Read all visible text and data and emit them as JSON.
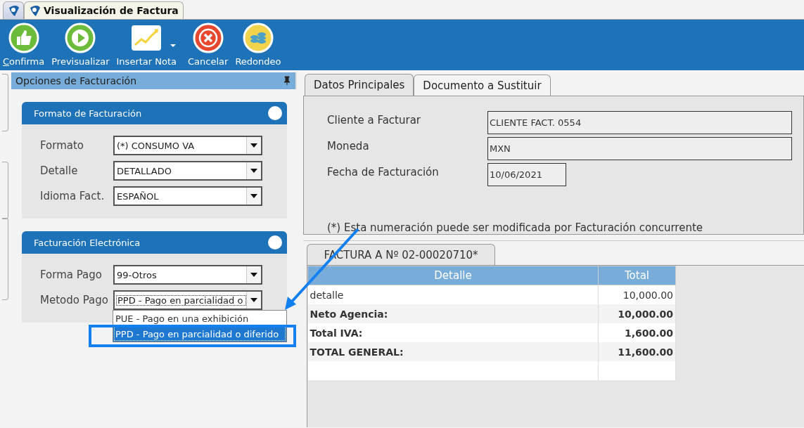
{
  "doc_tabs": [
    {
      "selected": false
    },
    {
      "label": "Visualización de Factura",
      "selected": true
    }
  ],
  "toolbar": [
    {
      "label": "Confirma",
      "underline_first": true,
      "has_menu": false
    },
    {
      "label": "Previsualizar",
      "underline_first": false,
      "has_menu": false
    },
    {
      "label": "Insertar Nota",
      "underline_first": false,
      "has_menu": true
    },
    {
      "label": "Cancelar",
      "underline_first": false,
      "has_menu": false
    },
    {
      "label": "Redondeo",
      "underline_first": false,
      "has_menu": false
    }
  ],
  "sidebar": {
    "title": "Opciones de Facturación",
    "groups": [
      {
        "title": "Formato de Facturación",
        "fields": [
          {
            "label": "Formato",
            "value": "(*) CONSUMO VA",
            "focused": false
          },
          {
            "label": "Detalle",
            "value": "DETALLADO",
            "focused": false
          },
          {
            "label": "Idioma Fact.",
            "value": "ESPAÑOL",
            "focused": false
          }
        ]
      },
      {
        "title": "Facturación Electrónica",
        "fields": [
          {
            "label": "Forma Pago",
            "value": "99-Otros",
            "focused": false
          },
          {
            "label": "Metodo Pago",
            "value": "PPD - Pago en parcialidad o",
            "focused": true,
            "options": [
              {
                "label": "PUE - Pago en una exhibición",
                "selected": false
              },
              {
                "label": "PPD - Pago en parcialidad o diferido",
                "selected": true,
                "annotated": true
              }
            ]
          }
        ]
      }
    ]
  },
  "main_tabs": [
    {
      "label": "Datos Principales",
      "selected": true
    },
    {
      "label": "Documento a Sustituir",
      "selected": false
    }
  ],
  "form": [
    {
      "label": "Cliente a Facturar",
      "value": "CLIENTE FACT. 0554",
      "wide": true
    },
    {
      "label": "Moneda",
      "value": "MXN",
      "wide": true
    },
    {
      "label": "Fecha de Facturación",
      "value": "10/06/2021",
      "wide": false
    }
  ],
  "note": "(*) Esta numeración puede ser modificada por Facturación concurrente",
  "invoice": {
    "tab": "FACTURA A Nº 02-00020710*",
    "columns": [
      "Detalle",
      "Total"
    ],
    "rows": [
      {
        "kind": "item",
        "cells": [
          "detalle",
          "10,000.00"
        ]
      },
      {
        "kind": "total",
        "cells": [
          "Neto Agencia:",
          "10,000.00"
        ]
      },
      {
        "kind": "total",
        "cells": [
          "Total IVA:",
          "1,600.00"
        ]
      },
      {
        "kind": "total",
        "cells": [
          "TOTAL GENERAL:",
          "11,600.00"
        ]
      }
    ]
  }
}
